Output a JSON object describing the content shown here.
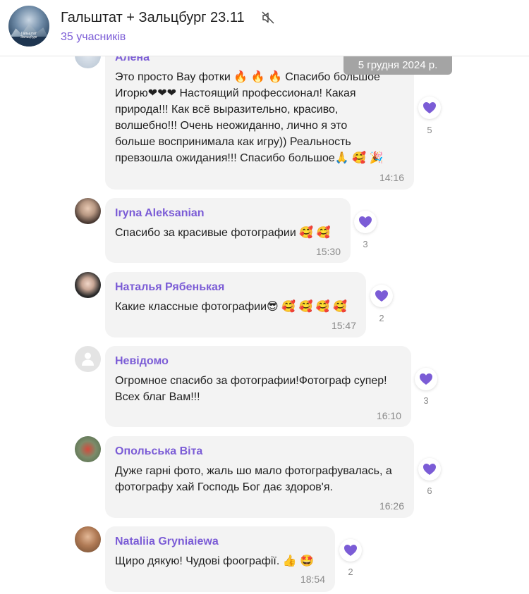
{
  "header": {
    "title": "Гальштат + Зальцбург 23.11",
    "members": "35 учасників",
    "avatar_caption": "Гальштат Зальцбург"
  },
  "date_separator": "5 грудня 2024 р.",
  "accent_color": "#7b5cd6",
  "messages": [
    {
      "sender": "Алена",
      "lines": [
        "Это просто Вау фотки 🔥 🔥 🔥  Спасибо большое",
        "Игорю❤❤❤ Настоящий профессионал! Какая",
        "природа!!! Как всё выразительно, красиво,",
        "волшебно!!! Очень неожиданно, лично я это",
        "больше воспринимала как игру)) Реальность",
        "превзошла ожидания!!! Спасибо большое🙏  🥰 🎉"
      ],
      "time": "14:16",
      "reaction_icon": "heart-icon",
      "reactions": "5"
    },
    {
      "sender": "Iryna Aleksanian",
      "lines": [
        "Спасибо за красивые фотографии 🥰 🥰"
      ],
      "time": "15:30",
      "reaction_icon": "heart-icon",
      "reactions": "3"
    },
    {
      "sender": "Наталья Рябенькая",
      "lines": [
        "Какие классные фотографии😎 🥰 🥰 🥰 🥰"
      ],
      "time": "15:47",
      "reaction_icon": "heart-icon",
      "reactions": "2"
    },
    {
      "sender": "Невідомо",
      "lines": [
        "Огромное спасибо за фотографии!Фотограф супер!",
        "Всех благ Вам!!!"
      ],
      "time": "16:10",
      "reaction_icon": "heart-icon",
      "reactions": "3"
    },
    {
      "sender": "Опольська Віта",
      "lines": [
        "Дуже гарні фото, жаль шо мало фотографувалась, а",
        "фотографу хай Господь Бог дає здоров'я."
      ],
      "time": "16:26",
      "reaction_icon": "heart-icon",
      "reactions": "6"
    },
    {
      "sender": "Nataliia Gryniaiewa",
      "lines": [
        "Щиро дякую! Чудові фоографії.  👍 🤩"
      ],
      "time": "18:54",
      "reaction_icon": "heart-icon",
      "reactions": "2"
    }
  ]
}
